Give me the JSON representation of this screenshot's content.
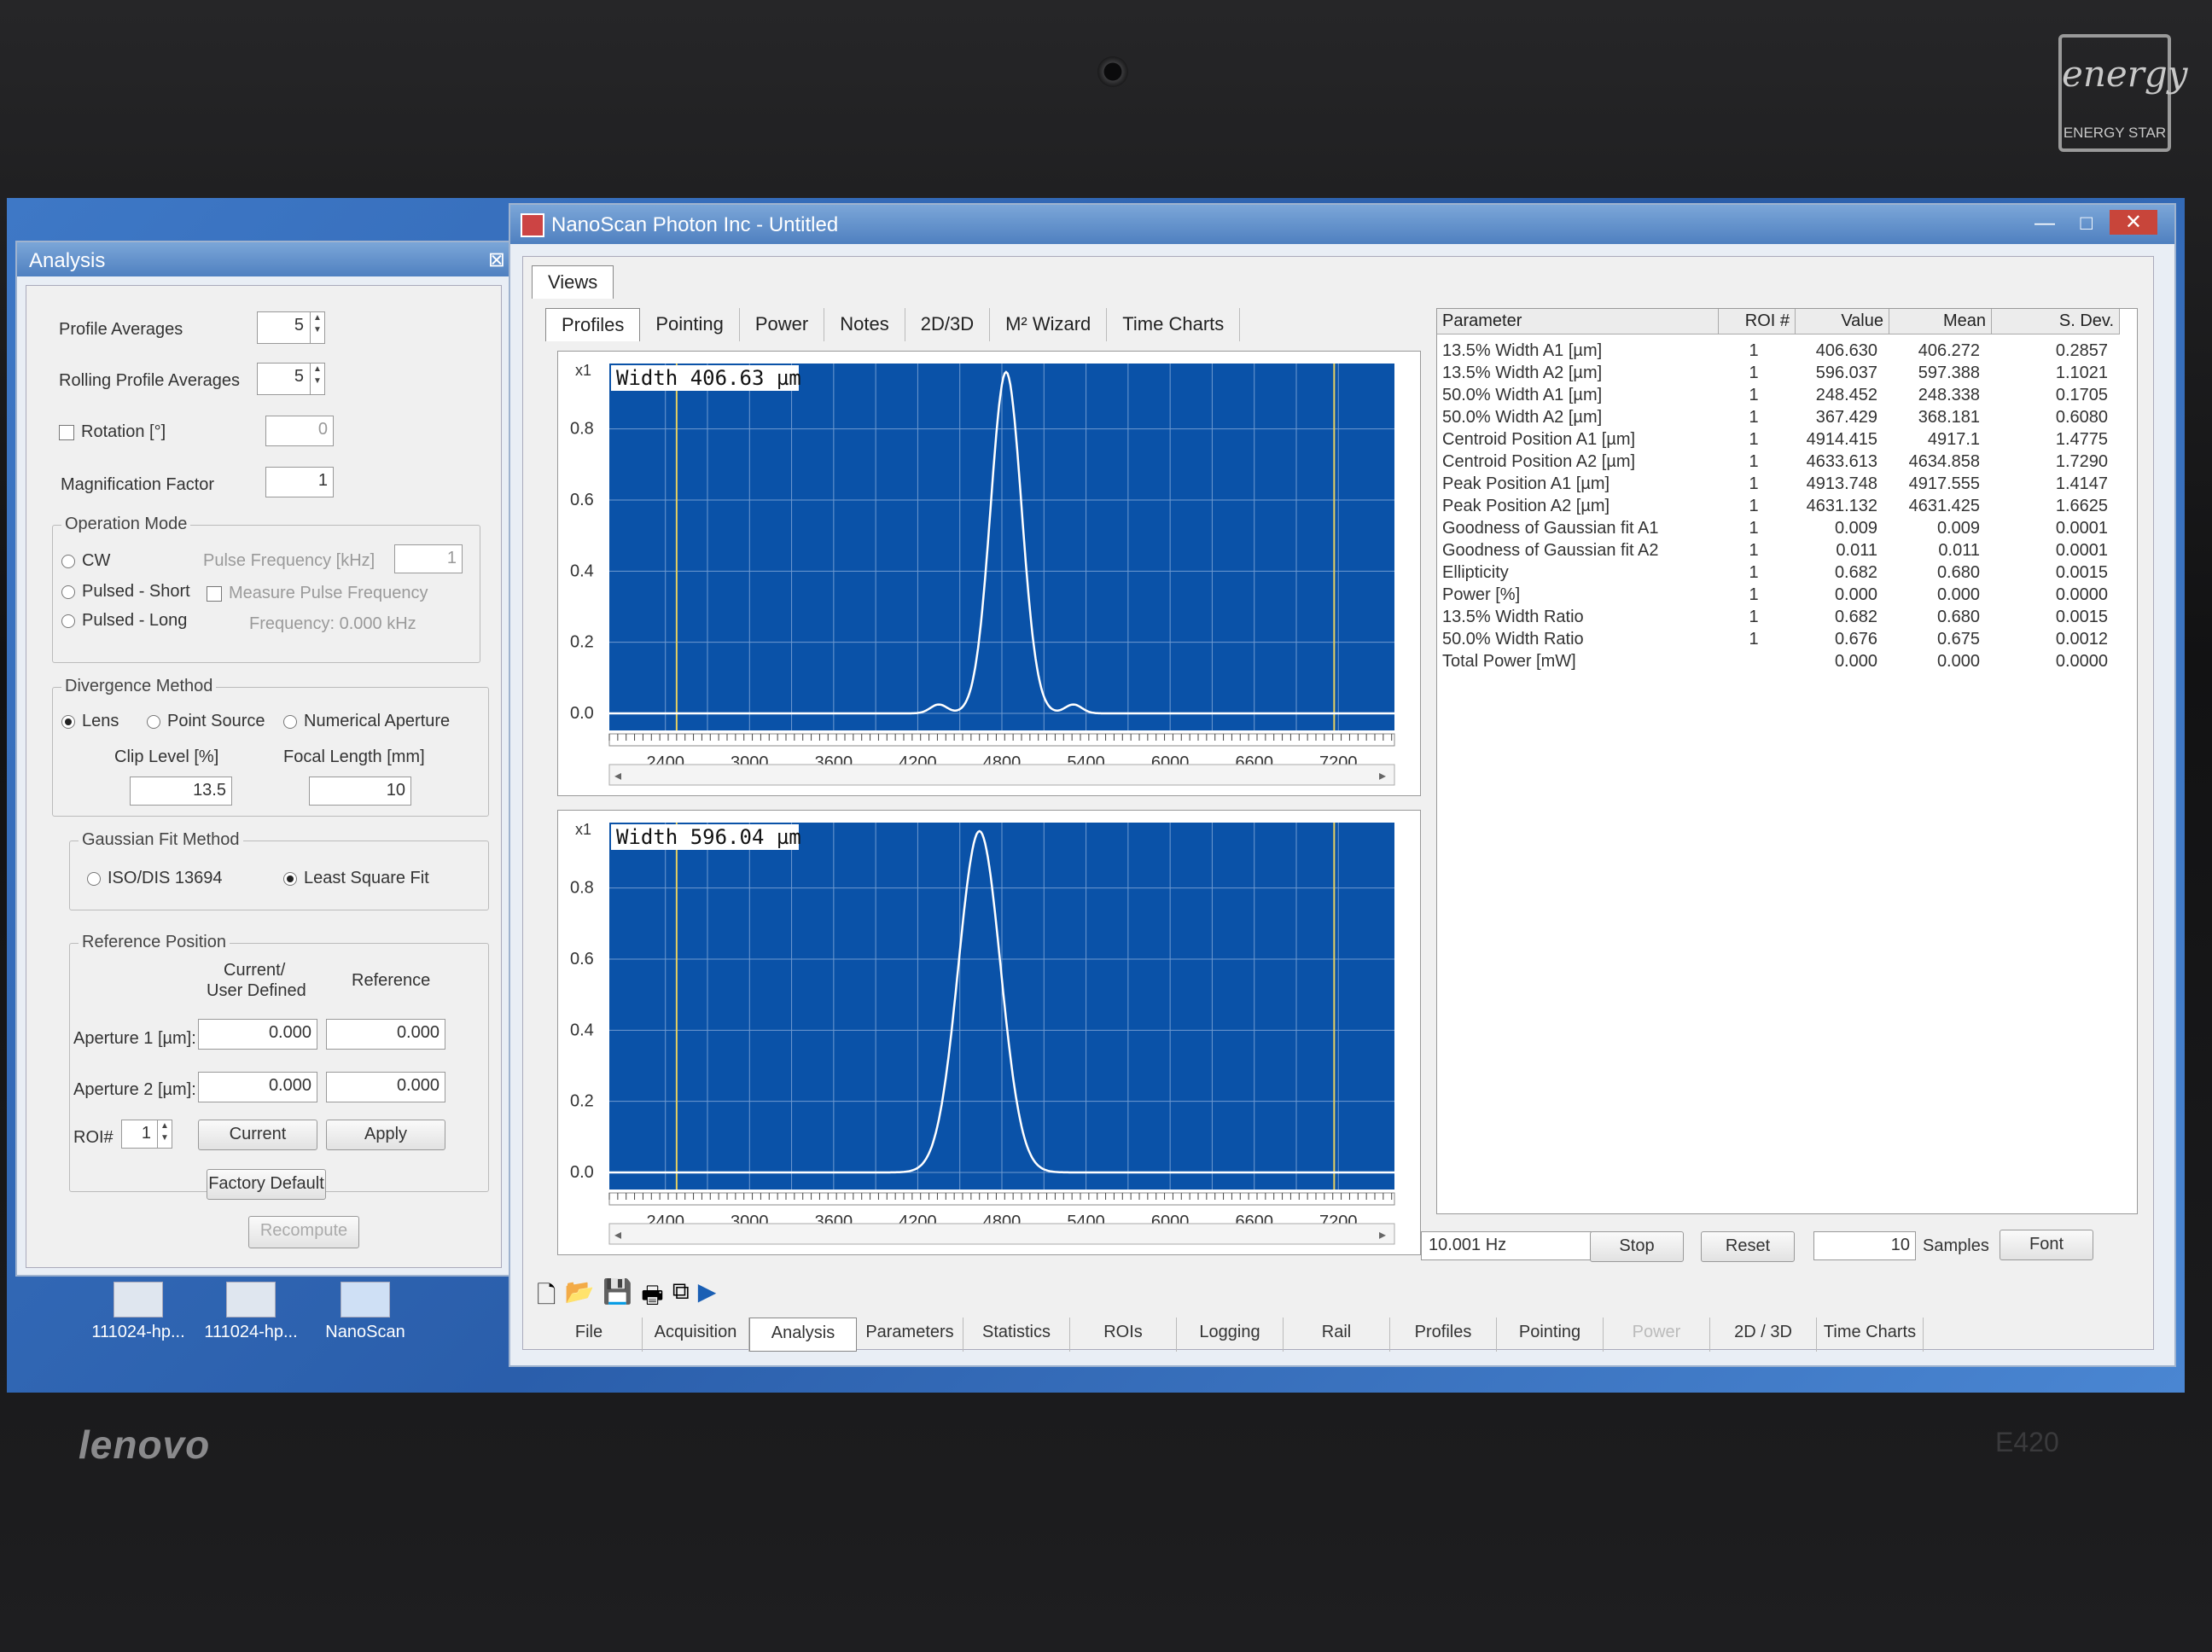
{
  "app_title": "NanoScan Photon Inc - Untitled",
  "window_controls": [
    "—",
    "□",
    "✕"
  ],
  "analysis_panel": {
    "title": "Analysis",
    "close": "⊠",
    "profile_averages_label": "Profile Averages",
    "profile_averages_value": "5",
    "rolling_label": "Rolling Profile Averages",
    "rolling_value": "5",
    "rotation_label": "Rotation [°]",
    "rotation_value": "0",
    "magnification_label": "Magnification Factor",
    "magnification_value": "1",
    "operation_mode": {
      "title": "Operation Mode",
      "cw": "CW",
      "pulsed_short": "Pulsed - Short",
      "pulsed_long": "Pulsed - Long",
      "pulse_freq_label": "Pulse Frequency [kHz]",
      "pulse_freq_value": "1",
      "measure_label": "Measure Pulse Frequency",
      "frequency_text": "Frequency: 0.000 kHz"
    },
    "divergence": {
      "title": "Divergence Method",
      "lens": "Lens",
      "point_source": "Point Source",
      "numerical_aperture": "Numerical Aperture",
      "clip_label": "Clip Level [%]",
      "clip_value": "13.5",
      "focal_label": "Focal Length [mm]",
      "focal_value": "10"
    },
    "gaussian": {
      "title": "Gaussian Fit Method",
      "iso": "ISO/DIS 13694",
      "lsf": "Least Square Fit"
    },
    "reference": {
      "title": "Reference Position",
      "col_current_1": "Current/",
      "col_current_2": "User Defined",
      "col_reference": "Reference",
      "ap1_label": "Aperture 1 [µm]:",
      "ap1_current": "0.000",
      "ap1_reference": "0.000",
      "ap2_label": "Aperture 2 [µm]:",
      "ap2_current": "0.000",
      "ap2_reference": "0.000",
      "roi_label": "ROI#",
      "roi_value": "1",
      "current_btn": "Current",
      "apply_btn": "Apply",
      "factory_btn": "Factory Default"
    },
    "recompute_btn": "Recompute"
  },
  "desktop_icons": [
    "111024-hp...",
    "111024-hp...",
    "NanoScan"
  ],
  "views_label": "Views",
  "view_tabs": [
    "Profiles",
    "Pointing",
    "Power",
    "Notes",
    "2D/3D",
    "M² Wizard",
    "Time Charts"
  ],
  "plots": [
    {
      "label": "Width 406.63 µm",
      "zoom": "x1",
      "yticks": [
        "0.8",
        "0.6",
        "0.4",
        "0.2",
        "0.0"
      ],
      "xticks": [
        "2400",
        "3000",
        "3600",
        "4200",
        "4800",
        "5400",
        "6000",
        "6600",
        "7200"
      ]
    },
    {
      "label": "Width 596.04 µm",
      "zoom": "x1",
      "yticks": [
        "0.8",
        "0.6",
        "0.4",
        "0.2",
        "0.0"
      ],
      "xticks": [
        "2400",
        "3000",
        "3600",
        "4200",
        "4800",
        "5400",
        "6000",
        "6600",
        "7200"
      ]
    }
  ],
  "stats": {
    "headers": [
      "Parameter",
      "ROI #",
      "Value",
      "Mean",
      "S. Dev."
    ],
    "rows": [
      [
        "13.5% Width A1 [µm]",
        "1",
        "406.630",
        "406.272",
        "0.2857"
      ],
      [
        "13.5% Width A2 [µm]",
        "1",
        "596.037",
        "597.388",
        "1.1021"
      ],
      [
        "50.0% Width A1 [µm]",
        "1",
        "248.452",
        "248.338",
        "0.1705"
      ],
      [
        "50.0% Width A2 [µm]",
        "1",
        "367.429",
        "368.181",
        "0.6080"
      ],
      [
        "Centroid Position A1 [µm]",
        "1",
        "4914.415",
        "4917.1",
        "1.4775"
      ],
      [
        "Centroid Position A2 [µm]",
        "1",
        "4633.613",
        "4634.858",
        "1.7290"
      ],
      [
        "Peak Position A1 [µm]",
        "1",
        "4913.748",
        "4917.555",
        "1.4147"
      ],
      [
        "Peak Position A2 [µm]",
        "1",
        "4631.132",
        "4631.425",
        "1.6625"
      ],
      [
        "Goodness of Gaussian fit A1",
        "1",
        "0.009",
        "0.009",
        "0.0001"
      ],
      [
        "Goodness of Gaussian fit A2",
        "1",
        "0.011",
        "0.011",
        "0.0001"
      ],
      [
        "Ellipticity",
        "1",
        "0.682",
        "0.680",
        "0.0015"
      ],
      [
        "Power [%]",
        "1",
        "0.000",
        "0.000",
        "0.0000"
      ],
      [
        "13.5% Width Ratio",
        "1",
        "0.682",
        "0.680",
        "0.0015"
      ],
      [
        "50.0% Width Ratio",
        "1",
        "0.676",
        "0.675",
        "0.0012"
      ],
      [
        "Total Power [mW]",
        "",
        "0.000",
        "0.000",
        "0.0000"
      ]
    ]
  },
  "status": {
    "freq": "10.001 Hz",
    "stop": "Stop",
    "reset": "Reset",
    "samples_value": "10",
    "samples_label": "Samples",
    "font": "Font"
  },
  "bottom_tabs": [
    "File",
    "Acquisition",
    "Analysis",
    "Parameters",
    "Statistics",
    "ROIs",
    "Logging",
    "Rail",
    "Profiles",
    "Pointing",
    "Power",
    "2D / 3D",
    "Time Charts"
  ],
  "bottom_active": "Analysis",
  "bottom_disabled": "Power",
  "energy_star": "ENERGY STAR",
  "energy_logo": "energy",
  "brand": "lenovo",
  "model": "E420",
  "colors": {
    "plot_bg": "#0a52a8",
    "grid": "#6f9ad0",
    "curve": "#ffffff",
    "marker": "#e8d060"
  }
}
